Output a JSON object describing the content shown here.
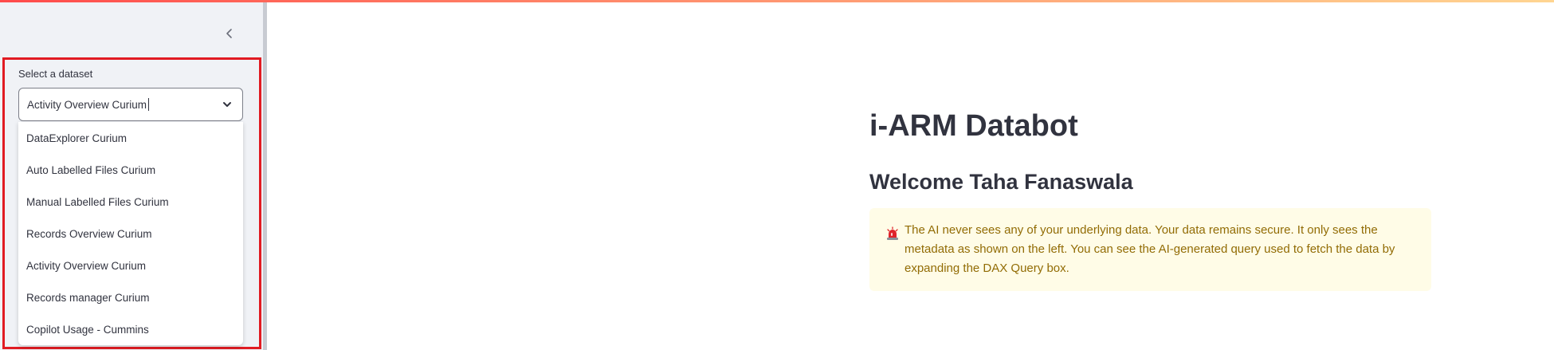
{
  "sidebar": {
    "select_label": "Select a dataset",
    "selected_value": "Activity Overview Curium",
    "options": [
      "DataExplorer Curium",
      "Auto Labelled Files Curium",
      "Manual Labelled Files Curium",
      "Records Overview Curium",
      "Activity Overview Curium",
      "Records manager Curium",
      "Copilot Usage - Cummins"
    ]
  },
  "main": {
    "title": "i-ARM Databot",
    "welcome": "Welcome Taha Fanaswala",
    "info_text": "The AI never sees any of your underlying data. Your data remains secure. It only sees the metadata as shown on the left. You can see the AI-generated query used to fetch the data by expanding the DAX Query box."
  },
  "colors": {
    "highlight": "#e11b22",
    "info_bg": "#fffce7",
    "info_text": "#926c05"
  },
  "icons": {
    "collapse": "chevron-left-icon",
    "dropdown": "chevron-down-icon",
    "info": "siren-icon"
  }
}
